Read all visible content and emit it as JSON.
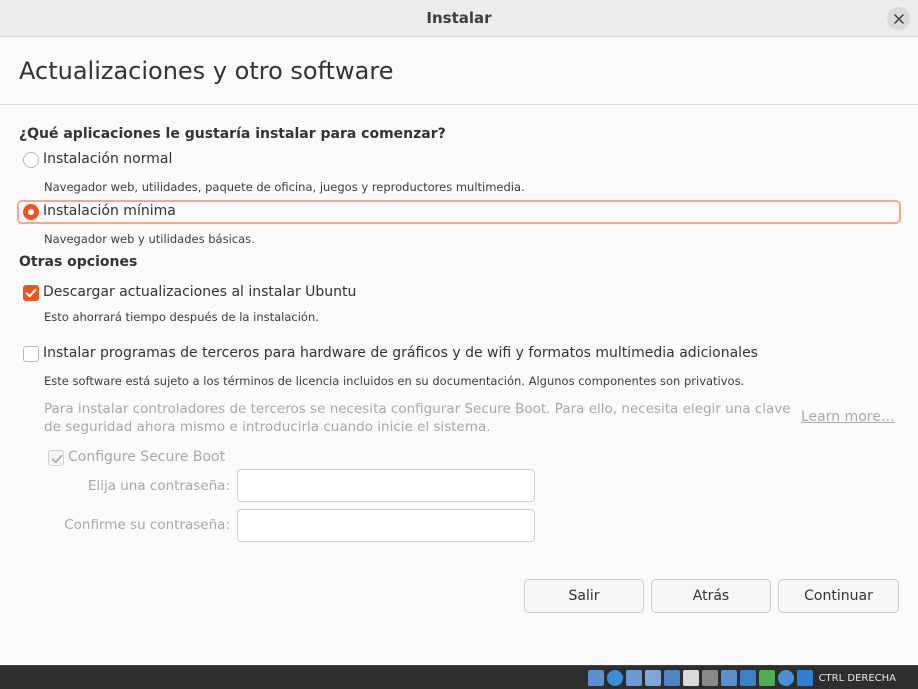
{
  "window": {
    "title": "Instalar",
    "page_title": "Actualizaciones y otro software"
  },
  "install_type": {
    "question": "¿Qué aplicaciones le gustaría instalar para comenzar?",
    "options": [
      {
        "label": "Instalación normal",
        "description": "Navegador web, utilidades, paquete de oficina, juegos y reproductores multimedia.",
        "selected": false
      },
      {
        "label": "Instalación mínima",
        "description": "Navegador web y utilidades básicas.",
        "selected": true
      }
    ]
  },
  "other_options": {
    "heading": "Otras opciones",
    "download_updates": {
      "label": "Descargar actualizaciones al instalar Ubuntu",
      "description": "Esto ahorrará tiempo después de la instalación.",
      "checked": true
    },
    "third_party": {
      "label": "Instalar programas de terceros para hardware de gráficos y de wifi y formatos multimedia adicionales",
      "description": "Este software está sujeto a los términos de licencia incluidos en su documentación. Algunos componentes son privativos.",
      "checked": false
    },
    "secure_boot_note_line1": "Para instalar controladores de terceros se necesita configurar Secure Boot. Para ello, necesita elegir una clave",
    "secure_boot_note_line2": "de seguridad ahora mismo e introducirla cuando inicie el sistema.",
    "learn_more": "Learn more…",
    "configure_secure_boot": {
      "label": "Configure Secure Boot",
      "checked": true,
      "disabled": true
    },
    "password_label": "Elija una contraseña:",
    "confirm_label": "Confirme su contraseña:",
    "password_value": "",
    "confirm_value": ""
  },
  "buttons": {
    "quit": "Salir",
    "back": "Atrás",
    "continue": "Continuar"
  },
  "taskbar": {
    "host_key": "CTRL DERECHA"
  },
  "colors": {
    "accent": "#e95420",
    "focus": "#f0a98a",
    "muted_text": "#a8a8a8"
  }
}
